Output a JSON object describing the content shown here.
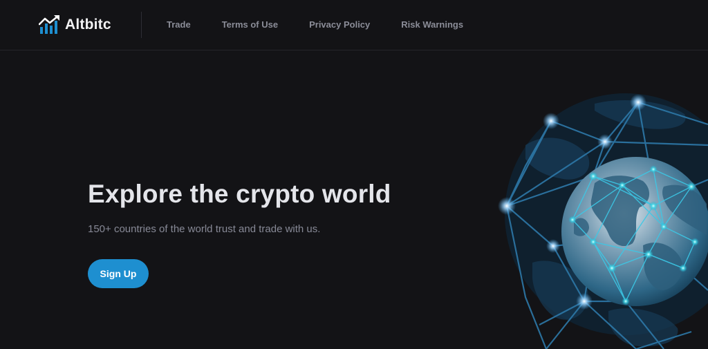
{
  "brand": {
    "name": "Altbitc",
    "logo_icon": "chart-trend-icon",
    "accent": "#1e8fd0"
  },
  "nav": {
    "items": [
      {
        "label": "Trade"
      },
      {
        "label": "Terms of Use"
      },
      {
        "label": "Privacy Policy"
      },
      {
        "label": "Risk Warnings"
      }
    ]
  },
  "hero": {
    "title": "Explore the crypto world",
    "subtitle": "150+ countries of the world trust and trade with us.",
    "cta_label": "Sign Up",
    "illustration_icon": "network-globe-icon"
  }
}
